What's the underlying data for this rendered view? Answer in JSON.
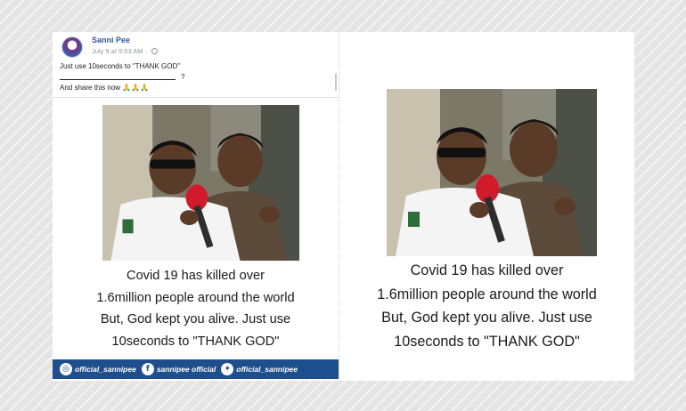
{
  "post": {
    "author": "Sanni Pee",
    "timestamp": "July 9 at 9:53 AM ·",
    "privacy_icon": "globe-icon",
    "line1": "Just use 10seconds to \"THANK GOD\"",
    "line2_suffix": "?",
    "line3": "And share this now 🙏🙏🙏"
  },
  "image_caption": {
    "line1": "Covid 19 has killed over",
    "line2": "1.6million people around the world",
    "line3": "But, God kept you alive. Just use",
    "line4": "10seconds to \"THANK GOD\""
  },
  "social_bar": {
    "instagram_label": "official_sannipee",
    "facebook_label": "sannipee official",
    "twitter_label": "official_sannipee",
    "colors": {
      "bar": "#1e4f8c",
      "text": "#ffffff"
    }
  },
  "colors": {
    "author_link": "#385898",
    "meta": "#90949c"
  }
}
